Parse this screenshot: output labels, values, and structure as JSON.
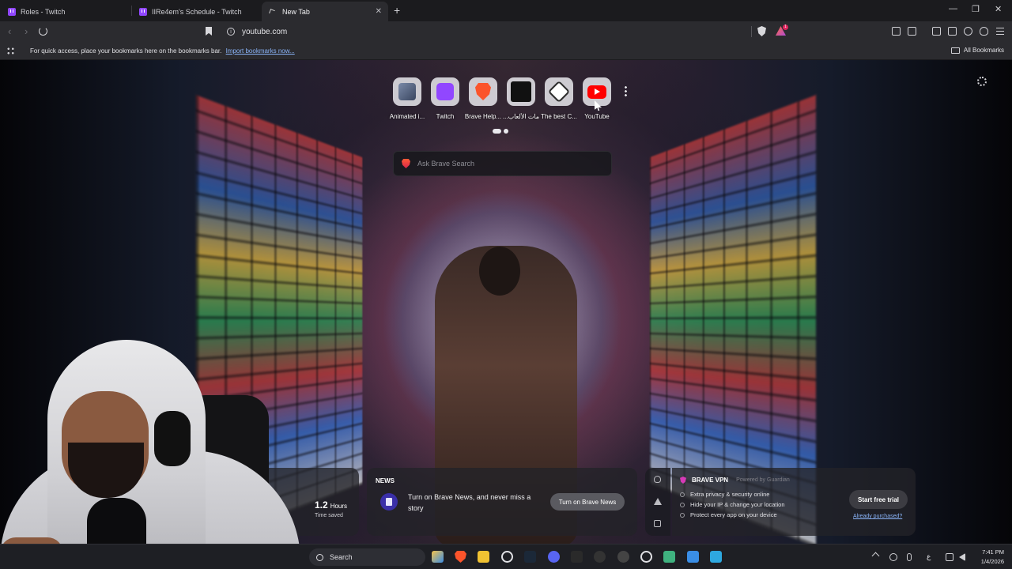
{
  "tabs": [
    {
      "title": "Roles - Twitch",
      "active": false
    },
    {
      "title": "IIRe4em's Schedule - Twitch",
      "active": false
    },
    {
      "title": "New Tab",
      "active": true
    }
  ],
  "address_bar": {
    "url": "youtube.com",
    "rewards_badge": "1"
  },
  "bookmarks_bar": {
    "message": "For quick access, place your bookmarks here on the bookmarks bar.",
    "import_link": "Import bookmarks now...",
    "all_bookmarks": "All Bookmarks"
  },
  "top_sites": [
    {
      "label": "Animated i...",
      "icon": "animated-icon",
      "color": "#5a6a8a"
    },
    {
      "label": "Twitch",
      "icon": "twitch-icon",
      "color": "#9147ff"
    },
    {
      "label": "Brave Help...",
      "icon": "brave-icon",
      "color": "#fb542b"
    },
    {
      "label": "...مات الألعاب",
      "icon": "games-icon",
      "color": "#111111"
    },
    {
      "label": "The best C...",
      "icon": "dice-icon",
      "color": "#2c2c2c"
    },
    {
      "label": "YouTube",
      "icon": "youtube-icon",
      "color": "#ff0000"
    }
  ],
  "search": {
    "placeholder": "Ask Brave Search"
  },
  "stats": {
    "value": "1.2",
    "unit": "Hours",
    "label": "Time saved"
  },
  "news": {
    "title": "NEWS",
    "text": "Turn on Brave News, and never miss a story",
    "button": "Turn on Brave News"
  },
  "vpn": {
    "name": "BRAVE VPN",
    "powered": "Powered by Guardian",
    "features": [
      "Extra privacy & security online",
      "Hide your IP & change your location",
      "Protect every app on your device"
    ],
    "button": "Start free trial",
    "link": "Already purchased?"
  },
  "taskbar": {
    "search": "Search",
    "time": "7:41 PM",
    "date": "1/4/2026",
    "lang": "ع"
  }
}
